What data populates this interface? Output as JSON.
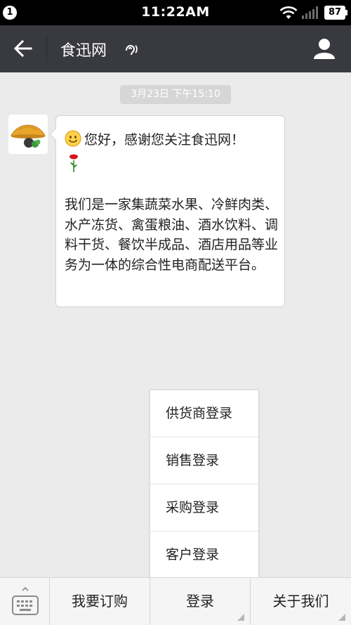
{
  "status_bar": {
    "notification_count": "1",
    "time": "11:22AM",
    "battery": "87",
    "icons": [
      "wifi-icon",
      "signal-icon",
      "battery-icon"
    ]
  },
  "header": {
    "title": "食迅网",
    "icons": [
      "back-arrow-icon",
      "ear-icon",
      "person-icon"
    ],
    "background": "#393a3f"
  },
  "chat": {
    "timestamp": "3月23日 下午15:10",
    "message": {
      "greeting": "您好，感谢您关注食迅网！",
      "body": "我们是一家集蔬菜水果、冷鲜肉类、水产冻货、禽蛋粮油、酒水饮料、调料干货、餐饮半成品、酒店用品等业务为一体的综合性电商配送平台。",
      "icons": [
        "smile-emoji-icon",
        "rose-emoji-icon"
      ]
    }
  },
  "popup_menu": {
    "items": [
      "供货商登录",
      "销售登录",
      "采购登录",
      "客户登录"
    ]
  },
  "bottom_menu": {
    "tabs": [
      "我要订购",
      "登录",
      "关于我们"
    ],
    "icons": [
      "keyboard-icon"
    ]
  },
  "colors": {
    "background": "#ebebeb",
    "header": "#393a3f",
    "status_bar": "#000000"
  }
}
